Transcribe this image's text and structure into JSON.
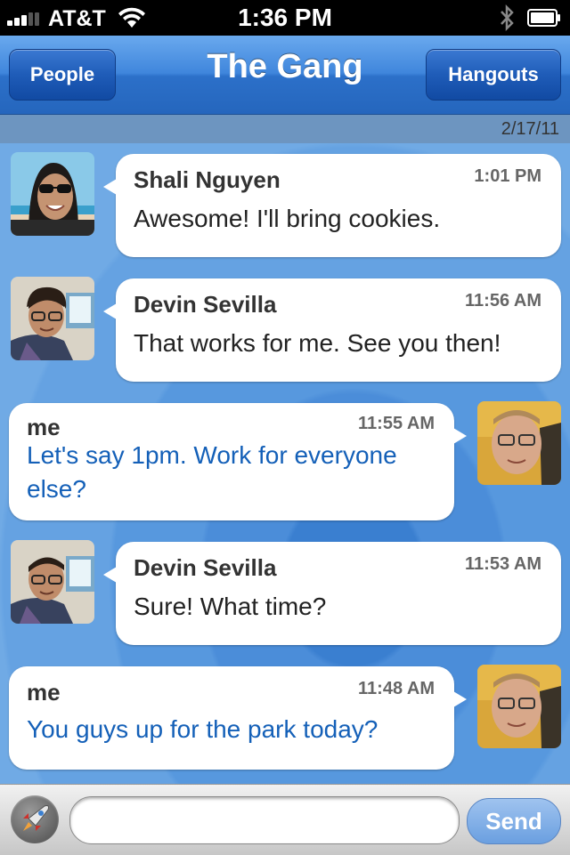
{
  "status_bar": {
    "carrier": "AT&T",
    "time": "1:36 PM",
    "wifi_icon": "wifi-icon",
    "bluetooth_icon": "bluetooth-icon",
    "battery_icon": "battery-icon"
  },
  "nav": {
    "left_button": "People",
    "title": "The Gang",
    "right_button": "Hangouts"
  },
  "date_header": "2/17/11",
  "messages": [
    {
      "sender": "Shali Nguyen",
      "time": "1:01 PM",
      "text": "Awesome! I'll bring cookies.",
      "mine": false
    },
    {
      "sender": "Devin Sevilla",
      "time": "11:56 AM",
      "text": "That works for me. See you then!",
      "mine": false
    },
    {
      "sender": "me",
      "time": "11:55 AM",
      "text_line1": "Let's say 1pm. Work for everyone",
      "text_line2": "else?",
      "mine": true
    },
    {
      "sender": "Devin Sevilla",
      "time": "11:53 AM",
      "text": "Sure! What time?",
      "mine": false
    },
    {
      "sender": "me",
      "time": "11:48 AM",
      "text": "You guys up for the park today?",
      "mine": true
    }
  ],
  "input": {
    "placeholder": "",
    "send_label": "Send",
    "attach_icon": "rocket-icon"
  },
  "colors": {
    "nav_blue": "#2c70c9",
    "my_message_text": "#1460b8",
    "background_blue": "#4a8ad6"
  }
}
